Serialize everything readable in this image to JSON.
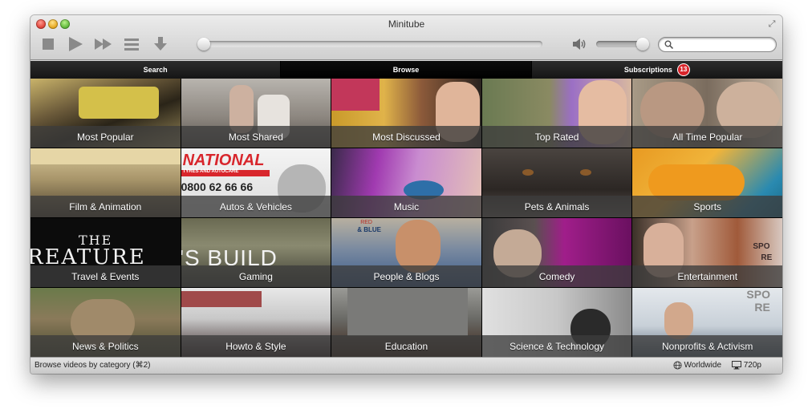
{
  "window": {
    "title": "Minitube"
  },
  "toolbar": {
    "buttons": [
      {
        "icon": "stop-icon"
      },
      {
        "icon": "play-icon"
      },
      {
        "icon": "skip-icon"
      },
      {
        "icon": "list-icon"
      },
      {
        "icon": "download-icon"
      }
    ],
    "seek_position": 0,
    "volume_level": 0.9,
    "search": {
      "value": "",
      "placeholder": ""
    }
  },
  "tabs": [
    {
      "label": "Search"
    },
    {
      "label": "Browse"
    },
    {
      "label": "Subscriptions",
      "badge": "13"
    }
  ],
  "categories": [
    {
      "label": "Most Popular"
    },
    {
      "label": "Most Shared"
    },
    {
      "label": "Most Discussed"
    },
    {
      "label": "Top Rated"
    },
    {
      "label": "All Time Popular"
    },
    {
      "label": "Film & Animation"
    },
    {
      "label": "Autos & Vehicles",
      "thumb_text": [
        "NATIONAL",
        "TYRES AND AUTOCARE",
        "0800 62 66 66"
      ]
    },
    {
      "label": "Music"
    },
    {
      "label": "Pets & Animals"
    },
    {
      "label": "Sports"
    },
    {
      "label": "Travel & Events",
      "thumb_text": [
        "THE",
        "REATURE"
      ]
    },
    {
      "label": "Gaming",
      "thumb_text": [
        "'S BUILD"
      ]
    },
    {
      "label": "People & Blogs",
      "thumb_text": [
        "RED",
        "& BLUE"
      ]
    },
    {
      "label": "Comedy"
    },
    {
      "label": "Entertainment",
      "thumb_text": [
        "SPO",
        "RE"
      ]
    },
    {
      "label": "News & Politics"
    },
    {
      "label": "Howto & Style"
    },
    {
      "label": "Education"
    },
    {
      "label": "Science & Technology"
    },
    {
      "label": "Nonprofits & Activism",
      "thumb_text": [
        "SPO",
        "RE"
      ]
    }
  ],
  "statusbar": {
    "text": "Browse videos by category (⌘2)",
    "region": "Worldwide",
    "quality": "720p"
  },
  "colors": {
    "tab_bar": "#1d1d1d",
    "badge": "#d9252b",
    "label_overlay": "#3c3c3c"
  }
}
